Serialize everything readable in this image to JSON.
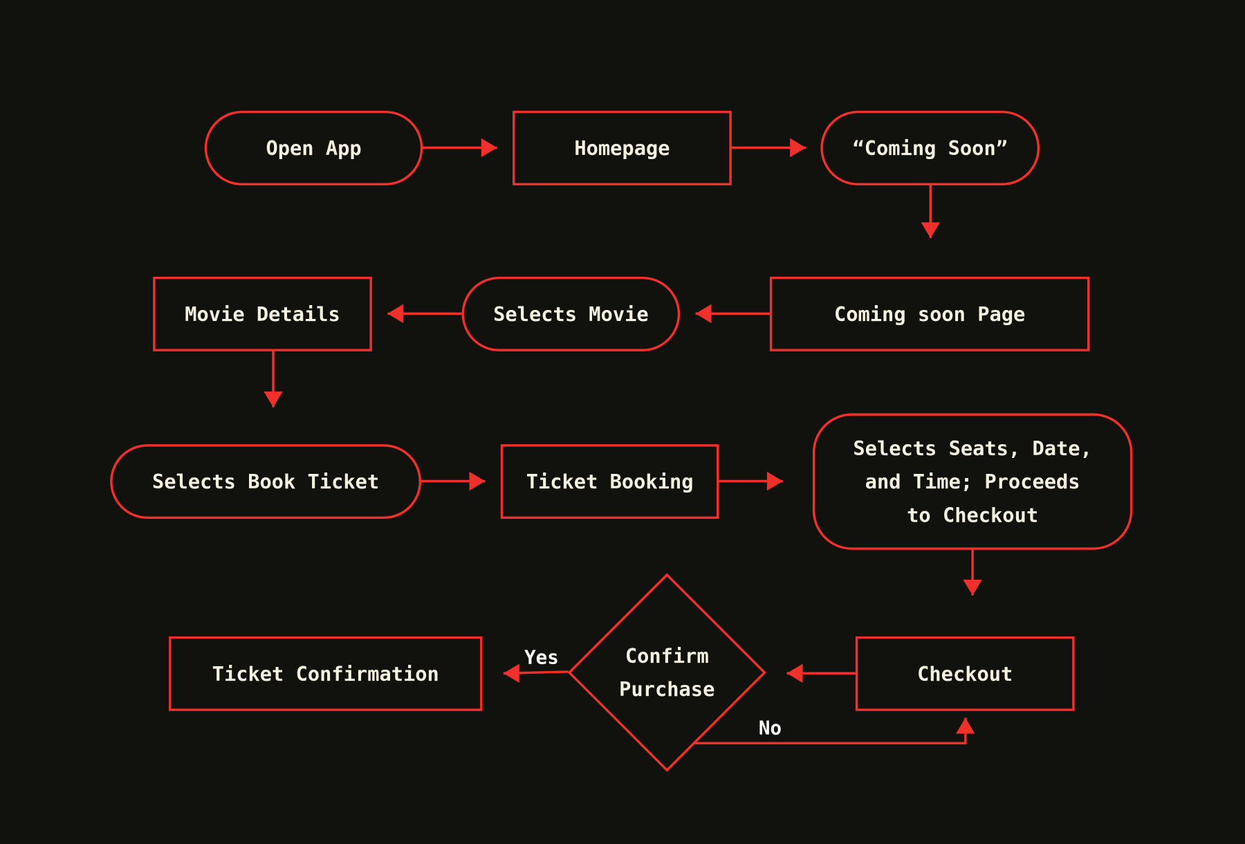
{
  "diagram": {
    "type": "flowchart",
    "colors": {
      "background": "#11110d",
      "stroke": "#f0302a",
      "text": "#f4f1df",
      "label": "#ffffff"
    },
    "nodes": [
      {
        "id": "open-app",
        "shape": "terminal",
        "lines": [
          "Open App"
        ]
      },
      {
        "id": "homepage",
        "shape": "process",
        "lines": [
          "Homepage"
        ]
      },
      {
        "id": "coming-soon",
        "shape": "terminal",
        "lines": [
          "“Coming Soon”"
        ]
      },
      {
        "id": "coming-soon-page",
        "shape": "process",
        "lines": [
          "Coming soon Page"
        ]
      },
      {
        "id": "selects-movie",
        "shape": "terminal",
        "lines": [
          "Selects Movie"
        ]
      },
      {
        "id": "movie-details",
        "shape": "process",
        "lines": [
          "Movie Details"
        ]
      },
      {
        "id": "selects-book-ticket",
        "shape": "terminal",
        "lines": [
          "Selects Book Ticket"
        ]
      },
      {
        "id": "ticket-booking",
        "shape": "process",
        "lines": [
          "Ticket Booking"
        ]
      },
      {
        "id": "selects-seats",
        "shape": "rounded",
        "lines": [
          "Selects Seats, Date,",
          "and Time; Proceeds",
          "to Checkout"
        ]
      },
      {
        "id": "checkout",
        "shape": "process",
        "lines": [
          "Checkout"
        ]
      },
      {
        "id": "confirm-purchase",
        "shape": "decision",
        "lines": [
          "Confirm",
          "Purchase"
        ]
      },
      {
        "id": "ticket-confirmation",
        "shape": "process",
        "lines": [
          "Ticket Confirmation"
        ]
      }
    ],
    "edges": [
      {
        "from": "open-app",
        "to": "homepage",
        "label": ""
      },
      {
        "from": "homepage",
        "to": "coming-soon",
        "label": ""
      },
      {
        "from": "coming-soon",
        "to": "coming-soon-page",
        "label": ""
      },
      {
        "from": "coming-soon-page",
        "to": "selects-movie",
        "label": ""
      },
      {
        "from": "selects-movie",
        "to": "movie-details",
        "label": ""
      },
      {
        "from": "movie-details",
        "to": "selects-book-ticket",
        "label": ""
      },
      {
        "from": "selects-book-ticket",
        "to": "ticket-booking",
        "label": ""
      },
      {
        "from": "ticket-booking",
        "to": "selects-seats",
        "label": ""
      },
      {
        "from": "selects-seats",
        "to": "checkout",
        "label": ""
      },
      {
        "from": "checkout",
        "to": "confirm-purchase",
        "label": ""
      },
      {
        "from": "confirm-purchase",
        "to": "ticket-confirmation",
        "label": "Yes"
      },
      {
        "from": "confirm-purchase",
        "to": "checkout",
        "label": "No"
      }
    ]
  }
}
